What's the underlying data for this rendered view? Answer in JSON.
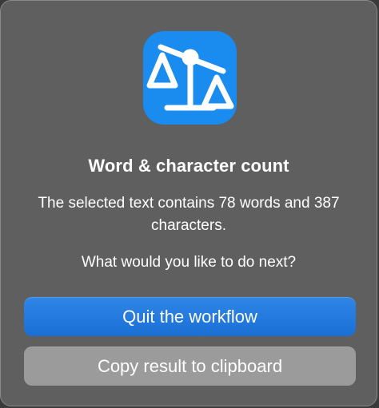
{
  "dialog": {
    "icon": "balance-scale-icon",
    "title": "Word & character count",
    "message": "The selected text contains 78 words and 387 characters.",
    "question": "What would you like to do next?"
  },
  "buttons": {
    "primary_label": "Quit the workflow",
    "secondary_label": "Copy result to clipboard"
  },
  "colors": {
    "dialog_background": "#5f5f5f",
    "icon_background": "#1a8cf0",
    "primary_button": "#1f76dc",
    "secondary_button": "#9b9b9b"
  }
}
